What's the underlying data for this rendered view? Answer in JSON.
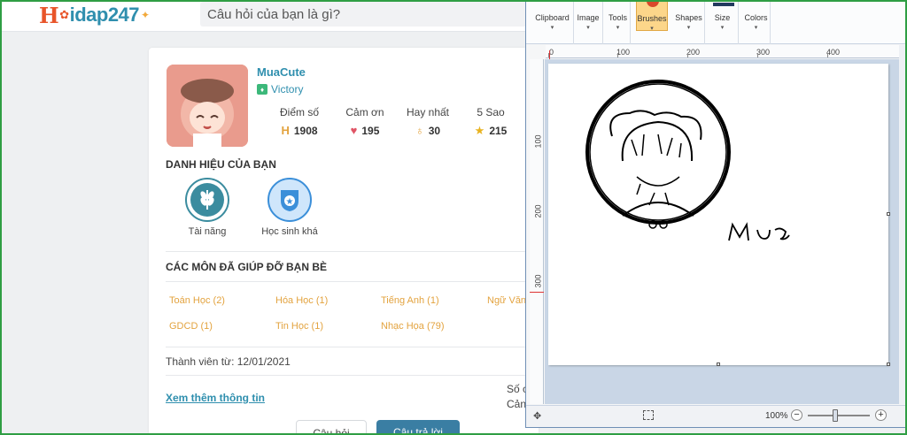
{
  "site": {
    "logo_text": "idap247",
    "search_placeholder": "Câu hỏi của bạn là gì?"
  },
  "profile": {
    "username": "MuaCute",
    "rank": "Victory",
    "stats": [
      {
        "label": "Điểm số",
        "value": "1908",
        "icon": "h-points-icon",
        "color": "#e3a33f"
      },
      {
        "label": "Cảm ơn",
        "value": "195",
        "icon": "heart-icon",
        "color": "#e05566"
      },
      {
        "label": "Hay nhất",
        "value": "30",
        "icon": "medal-icon",
        "color": "#e3a33f"
      },
      {
        "label": "5 Sao",
        "value": "215",
        "icon": "star-icon",
        "color": "#e8b21f"
      }
    ],
    "titles_heading": "DANH HIỆU CỦA BẠN",
    "badges": [
      {
        "label": "Tài năng",
        "icon": "wheat-badge-icon",
        "color": "#3b8c9f"
      },
      {
        "label": "Học sinh khá",
        "icon": "shield-star-badge-icon",
        "color": "#3b8fd9"
      }
    ],
    "subjects_heading": "CÁC MÔN ĐÃ GIÚP ĐỠ BẠN BÈ",
    "subjects": [
      "Toán Học (2)",
      "Hóa Học (1)",
      "Tiếng Anh (1)",
      "Ngữ Văn",
      "GDCD (1)",
      "Tin Học (1)",
      "Nhạc Họa (79)"
    ],
    "member_since": "Thành viên từ: 12/01/2021",
    "more_info_link": "Xem thêm thông tin",
    "side_text_1": "Số c",
    "side_text_2": "Cản",
    "tab_questions": "Câu hỏi",
    "tab_answers": "Câu trả lời"
  },
  "paint": {
    "ribbon": [
      {
        "label": "Clipboard"
      },
      {
        "label": "Image"
      },
      {
        "label": "Tools"
      },
      {
        "label": "Brushes"
      },
      {
        "label": "Shapes"
      },
      {
        "label": "Size"
      },
      {
        "label": "Colors"
      }
    ],
    "ruler_h": [
      "0",
      "100",
      "200",
      "300",
      "400"
    ],
    "ruler_v": [
      "100",
      "200",
      "300"
    ],
    "zoom": "100%",
    "drawing_signature": "Mưa"
  }
}
